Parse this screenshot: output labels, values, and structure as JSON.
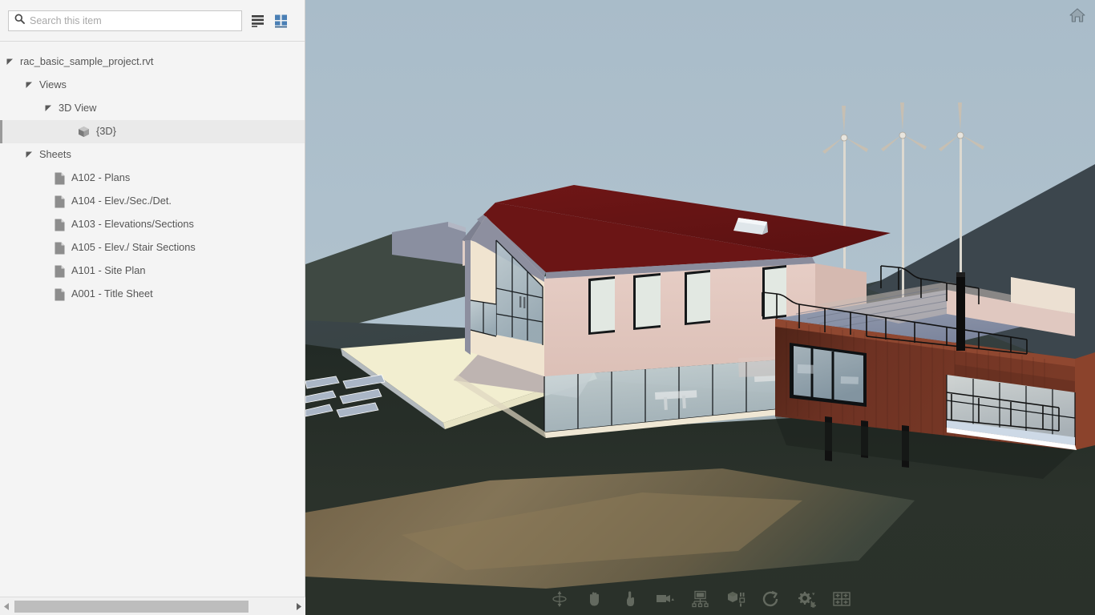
{
  "search": {
    "placeholder": "Search this item",
    "value": "",
    "icon": "search-icon"
  },
  "view_toggles": [
    {
      "name": "list-view-icon",
      "label": "List view",
      "active": false,
      "color": "#3d3d3d"
    },
    {
      "name": "grid-view-icon",
      "label": "Grid view",
      "active": true,
      "color": "#4a7fb5"
    }
  ],
  "tree": {
    "nodes": [
      {
        "label": "rac_basic_sample_project.rvt",
        "level": 0,
        "type": "file-root",
        "expanded": true,
        "selected": false
      },
      {
        "label": "Views",
        "level": 1,
        "type": "folder",
        "expanded": true,
        "selected": false
      },
      {
        "label": "3D View",
        "level": 2,
        "type": "folder",
        "expanded": true,
        "selected": false
      },
      {
        "label": "{3D}",
        "level": 3,
        "type": "view-3d",
        "expanded": false,
        "selected": true
      },
      {
        "label": "Sheets",
        "level": 1,
        "type": "folder",
        "expanded": true,
        "selected": false
      },
      {
        "label": "A102 - Plans",
        "level": 2,
        "type": "sheet",
        "expanded": false,
        "selected": false
      },
      {
        "label": "A104 - Elev./Sec./Det.",
        "level": 2,
        "type": "sheet",
        "expanded": false,
        "selected": false
      },
      {
        "label": "A103 - Elevations/Sections",
        "level": 2,
        "type": "sheet",
        "expanded": false,
        "selected": false
      },
      {
        "label": "A105 - Elev./ Stair Sections",
        "level": 2,
        "type": "sheet",
        "expanded": false,
        "selected": false
      },
      {
        "label": "A101 - Site Plan",
        "level": 2,
        "type": "sheet",
        "expanded": false,
        "selected": false
      },
      {
        "label": "A001 - Title Sheet",
        "level": 2,
        "type": "sheet",
        "expanded": false,
        "selected": false
      }
    ]
  },
  "scrollbar": {
    "left_arrow": "scroll-left-arrow",
    "right_arrow": "scroll-right-arrow"
  },
  "viewport": {
    "home_icon": "home-icon",
    "toolbar": [
      {
        "name": "orbit-icon",
        "label": "Orbit"
      },
      {
        "name": "pan-hand-icon",
        "label": "Pan"
      },
      {
        "name": "zoom-hand-icon",
        "label": "Zoom"
      },
      {
        "name": "camera-icon",
        "label": "Camera"
      },
      {
        "name": "model-structure-icon",
        "label": "Model structure"
      },
      {
        "name": "explode-cube-icon",
        "label": "Explode"
      },
      {
        "name": "reset-view-icon",
        "label": "Reset view"
      },
      {
        "name": "settings-gears-icon",
        "label": "Settings"
      },
      {
        "name": "viewports-grid-icon",
        "label": "Viewports"
      }
    ],
    "scene": {
      "description": "3D rendered architectural model of a two-wing house on a hillside",
      "colors": {
        "sky": "#aec0cc",
        "roof": "#6b1515",
        "wall_pink": "#e3c9c1",
        "gable_cream": "#f0e2cd",
        "wood_wing": "#6e3122",
        "terrain_dark": "#252b26",
        "terrain_hill": "#3b464c",
        "path_sand": "#8f7a5a",
        "patio_cream": "#f2eed0",
        "glass": "#c6d2d6",
        "frame_black": "#111111",
        "turbine_white": "#e6e4dc"
      },
      "wind_turbines": 3,
      "benches": 2,
      "skylights": 1
    }
  }
}
